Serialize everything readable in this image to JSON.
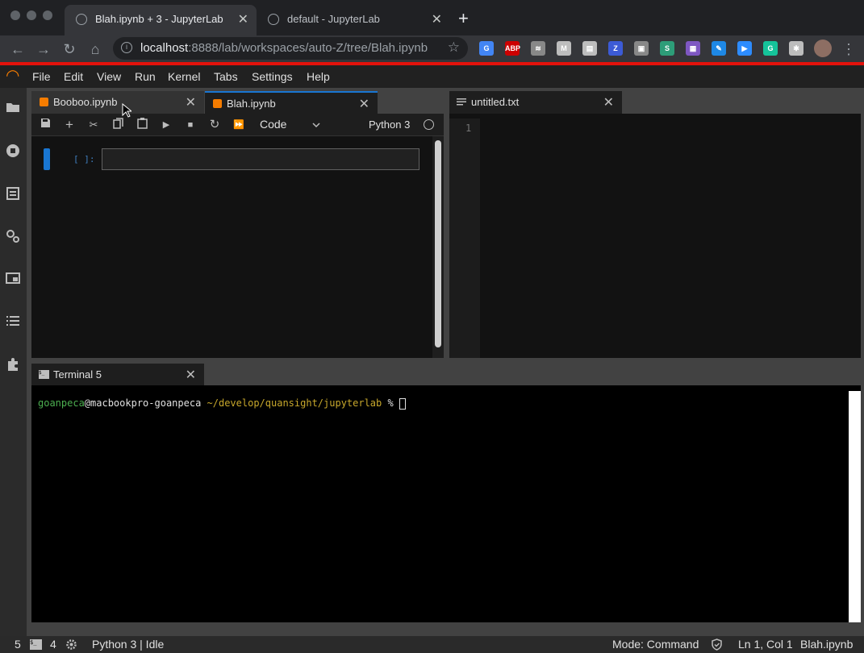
{
  "browser": {
    "tabs": [
      {
        "title": "Blah.ipynb + 3 - JupyterLab",
        "close": "✕",
        "active": true
      },
      {
        "title": "default - JupyterLab",
        "close": "✕",
        "active": false
      }
    ],
    "new_tab": "+",
    "url_host": "localhost",
    "url_path": ":8888/lab/workspaces/auto-Z/tree/Blah.ipynb",
    "nav": {
      "back": "←",
      "forward": "→",
      "reload": "↻",
      "home": "⌂",
      "star": "☆",
      "menu": "⋮"
    },
    "extensions": [
      "G",
      "ABP",
      "≋",
      "M",
      "▤",
      "Z",
      "▣",
      "S",
      "▦",
      "✎",
      "▶",
      "G",
      "✱"
    ]
  },
  "menubar": {
    "logo": "◠",
    "items": [
      "File",
      "Edit",
      "View",
      "Run",
      "Kernel",
      "Tabs",
      "Settings",
      "Help"
    ]
  },
  "leftbar": {
    "icons": [
      "folder-icon",
      "running-icon",
      "commands-icon",
      "property-inspector-icon",
      "tabs-icon",
      "toc-icon",
      "extension-icon"
    ]
  },
  "notebook": {
    "tabs": [
      {
        "title": "Booboo.ipynb",
        "close": "✕"
      },
      {
        "title": "Blah.ipynb",
        "close": "✕"
      }
    ],
    "toolbar": {
      "cell_type": "Code",
      "kernel": "Python 3"
    },
    "cell": {
      "prompt": "[ ]:"
    }
  },
  "editor": {
    "tab_title": "untitled.txt",
    "close": "✕",
    "line_number": "1"
  },
  "terminal": {
    "tab_title": "Terminal 5",
    "close": "✕",
    "user": "goanpeca",
    "host": "@macbookpro-goanpeca",
    "path": " ~/develop/quansight/jupyterlab",
    "prompt": " % "
  },
  "statusbar": {
    "terminals": "5",
    "kernels": "4",
    "kernel_status": "Python 3 | Idle",
    "mode": "Mode: Command",
    "position": "Ln 1, Col 1",
    "file": "Blah.ipynb"
  },
  "colors": {
    "accent": "#1976d2",
    "terminal_user": "#4caf50",
    "terminal_path": "#c8a82c",
    "red_bar": "#e3120b"
  }
}
